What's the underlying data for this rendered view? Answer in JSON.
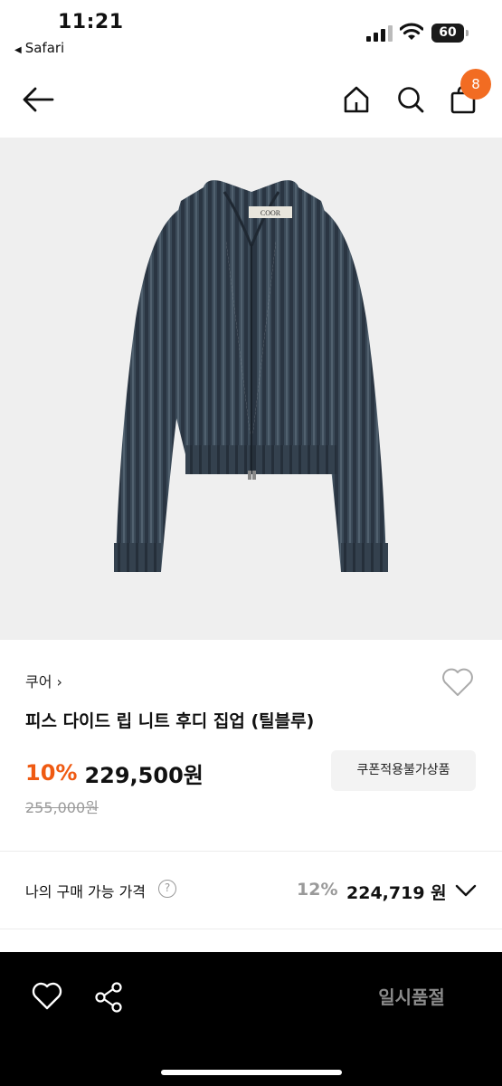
{
  "status_bar": {
    "time": "11:21",
    "back_app": "Safari",
    "battery": "60"
  },
  "nav": {
    "back_icon": "arrow-left-icon",
    "home_icon": "home-icon",
    "search_icon": "search-icon",
    "cart_icon": "shopping-bag-icon",
    "cart_count": "8"
  },
  "product": {
    "image_alt_icon": "ribbed-knit-hoodie-zipup-image",
    "tag_text": "COOR",
    "brand": "쿠어",
    "title": "피스 다이드 립 니트 후디 집업 (틸블루)",
    "discount": "10%",
    "sale_price": "229,500원",
    "original_price": "255,000원",
    "coupon_label": "쿠폰적용불가상품"
  },
  "my_price": {
    "label": "나의 구매 가능 가격",
    "help_icon_text": "?",
    "percent": "12%",
    "price": "224,719 원"
  },
  "bottom_bar": {
    "wish_icon": "heart-icon",
    "share_icon": "share-icon",
    "soldout_label": "일시품절"
  },
  "colors": {
    "accent": "#f26c22",
    "discount": "#ef5a12",
    "bottom_bar": "#000000",
    "garment": "#3b4a58"
  }
}
